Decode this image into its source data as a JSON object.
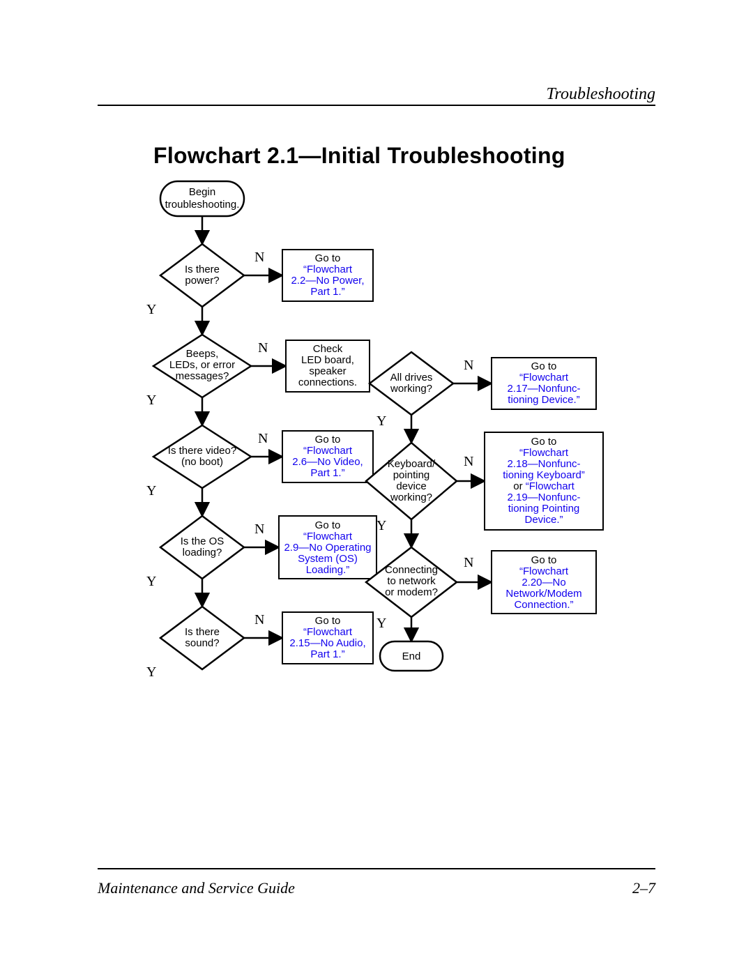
{
  "header": {
    "section": "Troubleshooting"
  },
  "title": "Flowchart 2.1—Initial Troubleshooting",
  "footer": {
    "left": "Maintenance and Service Guide",
    "right": "2–7"
  },
  "labels": {
    "yes": "Y",
    "no": "N"
  },
  "nodes": {
    "begin": {
      "l1": "Begin",
      "l2": "troubleshooting."
    },
    "power": {
      "l1": "Is there",
      "l2": "power?"
    },
    "beeps": {
      "l1": "Beeps,",
      "l2": "LEDs, or error",
      "l3": "messages?"
    },
    "video": {
      "l1": "Is there video?",
      "l2": "(no boot)"
    },
    "os": {
      "l1": "Is the OS",
      "l2": "loading?"
    },
    "sound": {
      "l1": "Is there",
      "l2": "sound?"
    },
    "drives": {
      "l1": "All drives",
      "l2": "working?"
    },
    "kbd": {
      "l1": "Keyboard/",
      "l2": "pointing",
      "l3": "device",
      "l4": "working?"
    },
    "net": {
      "l1": "Connecting",
      "l2": "to network",
      "l3": "or modem?"
    },
    "end": {
      "l1": "End"
    },
    "checkled": {
      "l1": "Check",
      "l2": "LED board,",
      "l3": "speaker",
      "l4": "connections."
    },
    "goto_power": {
      "pre": "Go to",
      "link": "\"Flowchart 2.2—No Power, Part 1.\""
    },
    "goto_video": {
      "pre": "Go to",
      "link": "\"Flowchart 2.6—No Video, Part 1.\""
    },
    "goto_os": {
      "pre": "Go to",
      "link": "\"Flowchart 2.9—No Operating System (OS) Loading.\""
    },
    "goto_audio": {
      "pre": "Go to",
      "link": "\"Flowchart 2.15—No Audio, Part 1.\""
    },
    "goto_device": {
      "pre": "Go to",
      "link": "\"Flowchart 2.17—Nonfunctioning Device.\""
    },
    "goto_kbd": {
      "pre": "Go to",
      "link1": "\"Flowchart 2.18—Nonfunctioning Keyboard\"",
      "mid": " or ",
      "link2": "\"Flowchart 2.19—Nonfunctioning Pointing Device.\""
    },
    "goto_net": {
      "pre": "Go to",
      "link": "\"Flowchart 2.20—No Network/Modem Connection.\""
    }
  },
  "chart_data": {
    "type": "flowchart",
    "title": "Flowchart 2.1—Initial Troubleshooting",
    "nodes": [
      {
        "id": "begin",
        "shape": "terminator",
        "text": "Begin troubleshooting."
      },
      {
        "id": "power",
        "shape": "decision",
        "text": "Is there power?"
      },
      {
        "id": "beeps",
        "shape": "decision",
        "text": "Beeps, LEDs, or error messages?"
      },
      {
        "id": "video",
        "shape": "decision",
        "text": "Is there video? (no boot)"
      },
      {
        "id": "os",
        "shape": "decision",
        "text": "Is the OS loading?"
      },
      {
        "id": "sound",
        "shape": "decision",
        "text": "Is there sound?"
      },
      {
        "id": "drives",
        "shape": "decision",
        "text": "All drives working?"
      },
      {
        "id": "kbd",
        "shape": "decision",
        "text": "Keyboard/pointing device working?"
      },
      {
        "id": "net",
        "shape": "decision",
        "text": "Connecting to network or modem?"
      },
      {
        "id": "end",
        "shape": "terminator",
        "text": "End"
      },
      {
        "id": "checkled",
        "shape": "process",
        "text": "Check LED board, speaker connections."
      },
      {
        "id": "gp",
        "shape": "process",
        "text": "Go to \"Flowchart 2.2—No Power, Part 1.\"",
        "link": true
      },
      {
        "id": "gv",
        "shape": "process",
        "text": "Go to \"Flowchart 2.6—No Video, Part 1.\"",
        "link": true
      },
      {
        "id": "go",
        "shape": "process",
        "text": "Go to \"Flowchart 2.9—No Operating System (OS) Loading.\"",
        "link": true
      },
      {
        "id": "ga",
        "shape": "process",
        "text": "Go to \"Flowchart 2.15—No Audio, Part 1.\"",
        "link": true
      },
      {
        "id": "gd",
        "shape": "process",
        "text": "Go to \"Flowchart 2.17—Nonfunctioning Device.\"",
        "link": true
      },
      {
        "id": "gk",
        "shape": "process",
        "text": "Go to \"Flowchart 2.18—Nonfunctioning Keyboard\" or \"Flowchart 2.19—Nonfunctioning Pointing Device.\"",
        "link": true
      },
      {
        "id": "gn",
        "shape": "process",
        "text": "Go to \"Flowchart 2.20—No Network/Modem Connection.\"",
        "link": true
      }
    ],
    "edges": [
      {
        "from": "begin",
        "to": "power"
      },
      {
        "from": "power",
        "to": "gp",
        "label": "N"
      },
      {
        "from": "power",
        "to": "beeps",
        "label": "Y"
      },
      {
        "from": "beeps",
        "to": "checkled",
        "label": "N"
      },
      {
        "from": "beeps",
        "to": "video",
        "label": "Y"
      },
      {
        "from": "video",
        "to": "gv",
        "label": "N"
      },
      {
        "from": "video",
        "to": "os",
        "label": "Y"
      },
      {
        "from": "os",
        "to": "go",
        "label": "N"
      },
      {
        "from": "os",
        "to": "sound",
        "label": "Y"
      },
      {
        "from": "sound",
        "to": "ga",
        "label": "N"
      },
      {
        "from": "sound",
        "to": "drives",
        "label": "Y"
      },
      {
        "from": "drives",
        "to": "gd",
        "label": "N"
      },
      {
        "from": "drives",
        "to": "kbd",
        "label": "Y"
      },
      {
        "from": "kbd",
        "to": "gk",
        "label": "N"
      },
      {
        "from": "kbd",
        "to": "net",
        "label": "Y"
      },
      {
        "from": "net",
        "to": "gn",
        "label": "N"
      },
      {
        "from": "net",
        "to": "end",
        "label": "Y"
      }
    ]
  }
}
